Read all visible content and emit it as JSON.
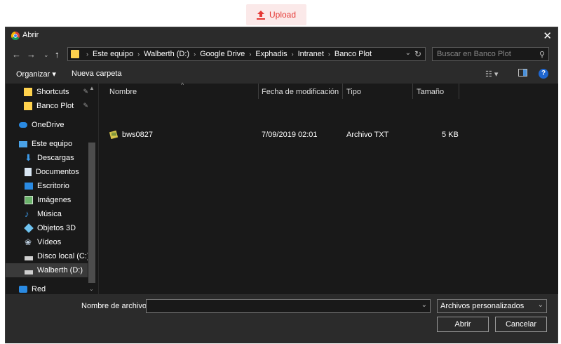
{
  "upload": {
    "label": "Upload",
    "color": "#e53935"
  },
  "dialog": {
    "title": "Abrir",
    "close_glyph": "✕",
    "breadcrumbs": [
      "Este equipo",
      "Walberth (D:)",
      "Google Drive",
      "Exphadis",
      "Intranet",
      "Banco Plot"
    ],
    "search_placeholder": "Buscar en Banco Plot",
    "toolbar": {
      "organize_label": "Organizar ▾",
      "new_folder_label": "Nueva carpeta",
      "help_label": "?"
    },
    "sidebar": [
      {
        "label": "Shortcuts",
        "icon": "folder-icon",
        "pinned": true
      },
      {
        "label": "Banco Plot",
        "icon": "folder-icon",
        "pinned": true
      },
      {
        "label": "OneDrive",
        "icon": "cloud-icon"
      },
      {
        "label": "Este equipo",
        "icon": "computer-icon"
      },
      {
        "label": "Descargas",
        "icon": "download-icon"
      },
      {
        "label": "Documentos",
        "icon": "documents-icon"
      },
      {
        "label": "Escritorio",
        "icon": "desktop-icon"
      },
      {
        "label": "Imágenes",
        "icon": "pictures-icon"
      },
      {
        "label": "Música",
        "icon": "music-icon"
      },
      {
        "label": "Objetos 3D",
        "icon": "objects3d-icon"
      },
      {
        "label": "Vídeos",
        "icon": "videos-icon"
      },
      {
        "label": "Disco local (C:)",
        "icon": "drive-icon"
      },
      {
        "label": "Walberth (D:)",
        "icon": "drive-icon",
        "selected": true
      },
      {
        "label": "Red",
        "icon": "network-icon"
      }
    ],
    "columns": {
      "name": "Nombre",
      "modified": "Fecha de modificación",
      "type": "Tipo",
      "size": "Tamaño"
    },
    "files": [
      {
        "name": "bws0827",
        "modified": "7/09/2019 02:01",
        "type": "Archivo TXT",
        "size": "5 KB"
      }
    ],
    "filename_label": "Nombre de archivo:",
    "filename_value": "",
    "filetype_value": "Archivos personalizados",
    "open_label": "Abrir",
    "cancel_label": "Cancelar"
  }
}
